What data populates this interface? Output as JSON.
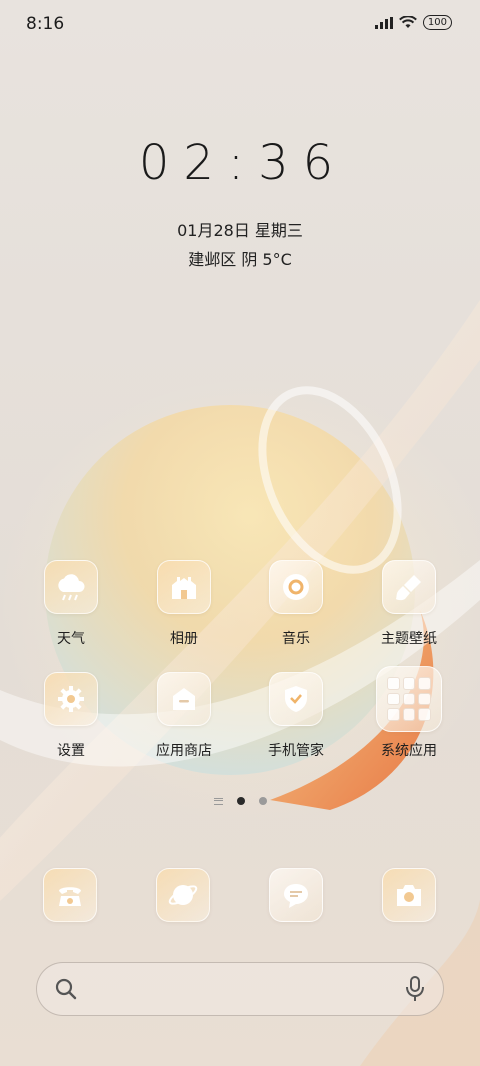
{
  "status_bar": {
    "time": "8:16",
    "battery": "100",
    "signal_icon": "signal-bars-icon",
    "wifi_icon": "wifi-icon"
  },
  "lock_clock": {
    "time": "02:36",
    "date": "01月28日 星期三",
    "weather": "建邺区 阴 5°C"
  },
  "apps": [
    {
      "label": "天气",
      "icon": "weather-icon"
    },
    {
      "label": "相册",
      "icon": "gallery-icon"
    },
    {
      "label": "音乐",
      "icon": "music-icon"
    },
    {
      "label": "主题壁纸",
      "icon": "theme-brush-icon"
    },
    {
      "label": "设置",
      "icon": "gear-icon"
    },
    {
      "label": "应用商店",
      "icon": "app-store-icon"
    },
    {
      "label": "手机管家",
      "icon": "shield-icon"
    },
    {
      "label": "系统应用",
      "icon": "folder-icon"
    }
  ],
  "pager": {
    "pages": 2,
    "current": 1
  },
  "dock": [
    {
      "icon": "phone-icon"
    },
    {
      "icon": "browser-planet-icon"
    },
    {
      "icon": "messages-icon"
    },
    {
      "icon": "camera-icon"
    }
  ],
  "search": {
    "placeholder": ""
  },
  "colors": {
    "accent_orange": "#f2a53a",
    "text_dark": "#1f1f1f"
  }
}
